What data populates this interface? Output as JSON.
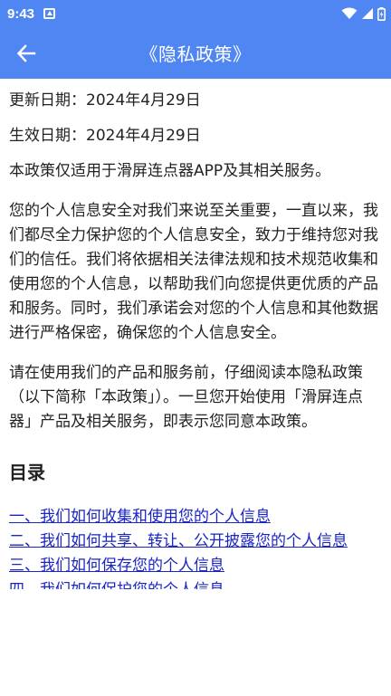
{
  "status_bar": {
    "time": "9:43",
    "icons": [
      "notification-icon",
      "wifi-icon",
      "signal-icon",
      "battery-icon"
    ]
  },
  "app_bar": {
    "title": "《隐私政策》",
    "back_icon": "arrow-left-icon"
  },
  "content": {
    "updated_date": "更新日期：2024年4月29日",
    "effective_date": "生效日期：2024年4月29日",
    "paragraphs": [
      "本政策仅适用于滑屏连点器APP及其相关服务。",
      "您的个人信息安全对我们来说至关重要，一直以来，我们都尽全力保护您的个人信息安全，致力于维持您对我们的信任。我们将依据相关法律法规和技术规范收集和使用您的个人信息，以帮助我们向您提供更优质的产品和服务。同时，我们承诺会对您的个人信息和其他数据进行严格保密，确保您的个人信息安全。",
      "请在使用我们的产品和服务前，仔细阅读本隐私政策（以下简称「本政策」）。一旦您开始使用「滑屏连点器」产品及相关服务，即表示您同意本政策。"
    ],
    "toc_heading": "目录",
    "toc_items": [
      "一、我们如何收集和使用您的个人信息",
      "二、我们如何共享、转让、公开披露您的个人信息",
      "三、我们如何保存您的个人信息",
      "四、我们如何保护您的个人信息"
    ]
  },
  "colors": {
    "primary": "#4f86f2",
    "link": "#1a25c4",
    "text": "#222222",
    "background": "#ffffff"
  }
}
